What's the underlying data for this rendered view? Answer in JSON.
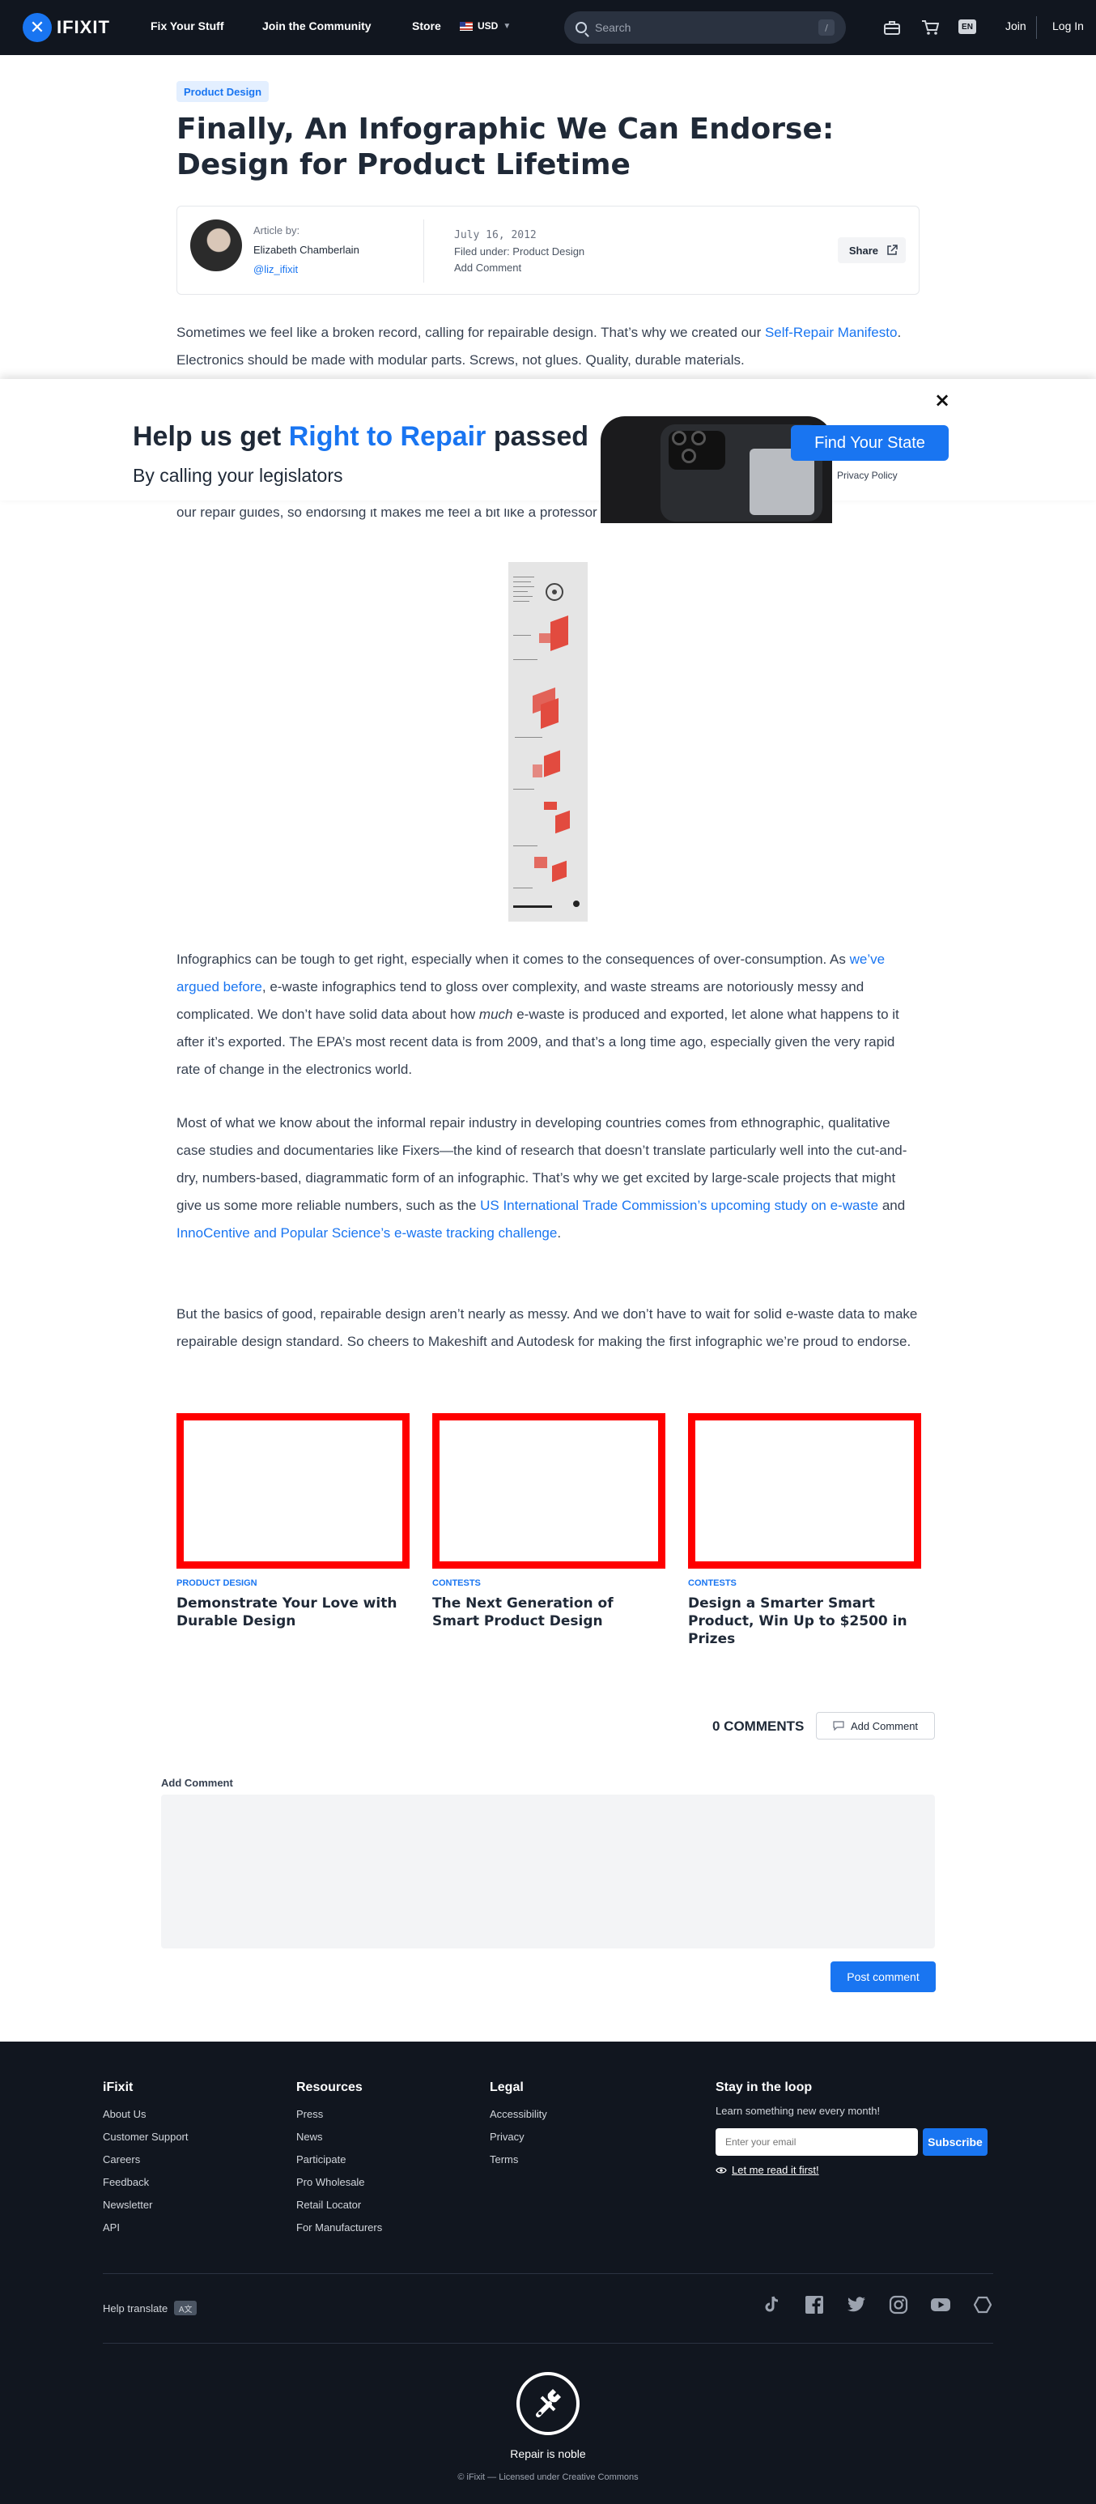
{
  "nav": {
    "logo_text": "IFIXIT",
    "links": [
      "Fix Your Stuff",
      "Join the Community",
      "Store"
    ],
    "currency": "USD",
    "search_placeholder": "Search",
    "search_shortcut": "/",
    "language": "EN",
    "join": "Join",
    "login": "Log In"
  },
  "article": {
    "category": "Product Design",
    "title": "Finally, An Infographic We Can Endorse: Design for Product Lifetime",
    "author_label": "Article by:",
    "author_name": "Elizabeth Chamberlain",
    "author_handle": "@liz_ifixit",
    "date": "July 16, 2012",
    "filed_label": "Filed under:",
    "filed_value": "Product Design",
    "add_comment": "Add Comment",
    "share": "Share",
    "p1_before": "Sometimes we feel like a broken record, calling for repairable design. That’s why we created our ",
    "p1_link": "Self-Repair Manifesto",
    "p1_after": ". Electronics should be made with modular parts. Screws, not glues. Quality, durable materials.",
    "p_hidden_tail": "our repair guides, so endorsing it makes me feel a bit like a professor who assigns her own book.)",
    "p2_a": "Infographics can be tough to get right, especially when it comes to the consequences of over-consumption. As ",
    "p2_link": "we’ve argued before",
    "p2_b": ", e-waste infographics tend to gloss over complexity, and waste streams are notoriously messy and complicated. We don’t have solid data about how ",
    "p2_em": "much",
    "p2_c": " e-waste is produced and exported, let alone what happens to it after it’s exported. The EPA’s most recent data is from 2009, and that’s a long time ago, especially given the very rapid rate of change in the electronics world.",
    "p3_a": "Most of what we know about the informal repair industry in developing countries comes from ethnographic, qualitative case studies and documentaries like Fixers—the kind of research that doesn’t translate particularly well into the cut-and-dry, numbers-based, diagrammatic form of an infographic. That’s why we get excited by large-scale projects that might give us some more reliable numbers, such as the ",
    "p3_link1": "US International Trade Commission’s upcoming study on e-waste",
    "p3_b": " and ",
    "p3_link2": "InnoCentive and Popular Science’s e-waste tracking challenge",
    "p3_c": ".",
    "p4": "But the basics of good, repairable design aren’t nearly as messy. And we don’t have to wait for solid e-waste data to make repairable design standard. So cheers to Makeshift and Autodesk for making the first infographic we’re proud to endorse."
  },
  "banner": {
    "title_a": "Help us get ",
    "title_hl": "Right to Repair",
    "title_b": " passed",
    "subtitle": "By calling your legislators",
    "cta": "Find Your State",
    "privacy": "Privacy Policy",
    "close": "×"
  },
  "related": [
    {
      "category": "PRODUCT DESIGN",
      "title": "Demonstrate Your Love with Durable Design"
    },
    {
      "category": "CONTESTS",
      "title": "The Next Generation of Smart Product Design"
    },
    {
      "category": "CONTESTS",
      "title": "Design a Smarter Smart Product, Win Up to $2500 in Prizes"
    }
  ],
  "comments": {
    "count_label": "0 COMMENTS",
    "add_button": "Add Comment",
    "form_label": "Add Comment",
    "post_button": "Post comment"
  },
  "footer": {
    "col1_title": "iFixit",
    "col1": [
      "About Us",
      "Customer Support",
      "Careers",
      "Feedback",
      "Newsletter",
      "API"
    ],
    "col2_title": "Resources",
    "col2": [
      "Press",
      "News",
      "Participate",
      "Pro Wholesale",
      "Retail Locator",
      "For Manufacturers"
    ],
    "col3_title": "Legal",
    "col3": [
      "Accessibility",
      "Privacy",
      "Terms"
    ],
    "newsletter_title": "Stay in the loop",
    "newsletter_desc": "Learn something new every month!",
    "email_placeholder": "Enter your email",
    "subscribe": "Subscribe",
    "read_first": "Let me read it first!",
    "help_translate": "Help translate",
    "translate_badge": "A文",
    "socials": [
      "tiktok-icon",
      "facebook-icon",
      "twitter-icon",
      "instagram-icon",
      "youtube-icon",
      "hive-icon"
    ],
    "tagline": "Repair is noble",
    "copyright": "© iFixit — Licensed under Creative Commons"
  },
  "colors": {
    "accent": "#1975f1",
    "nav_bg": "#11161f",
    "related_border": "#ff0000"
  }
}
